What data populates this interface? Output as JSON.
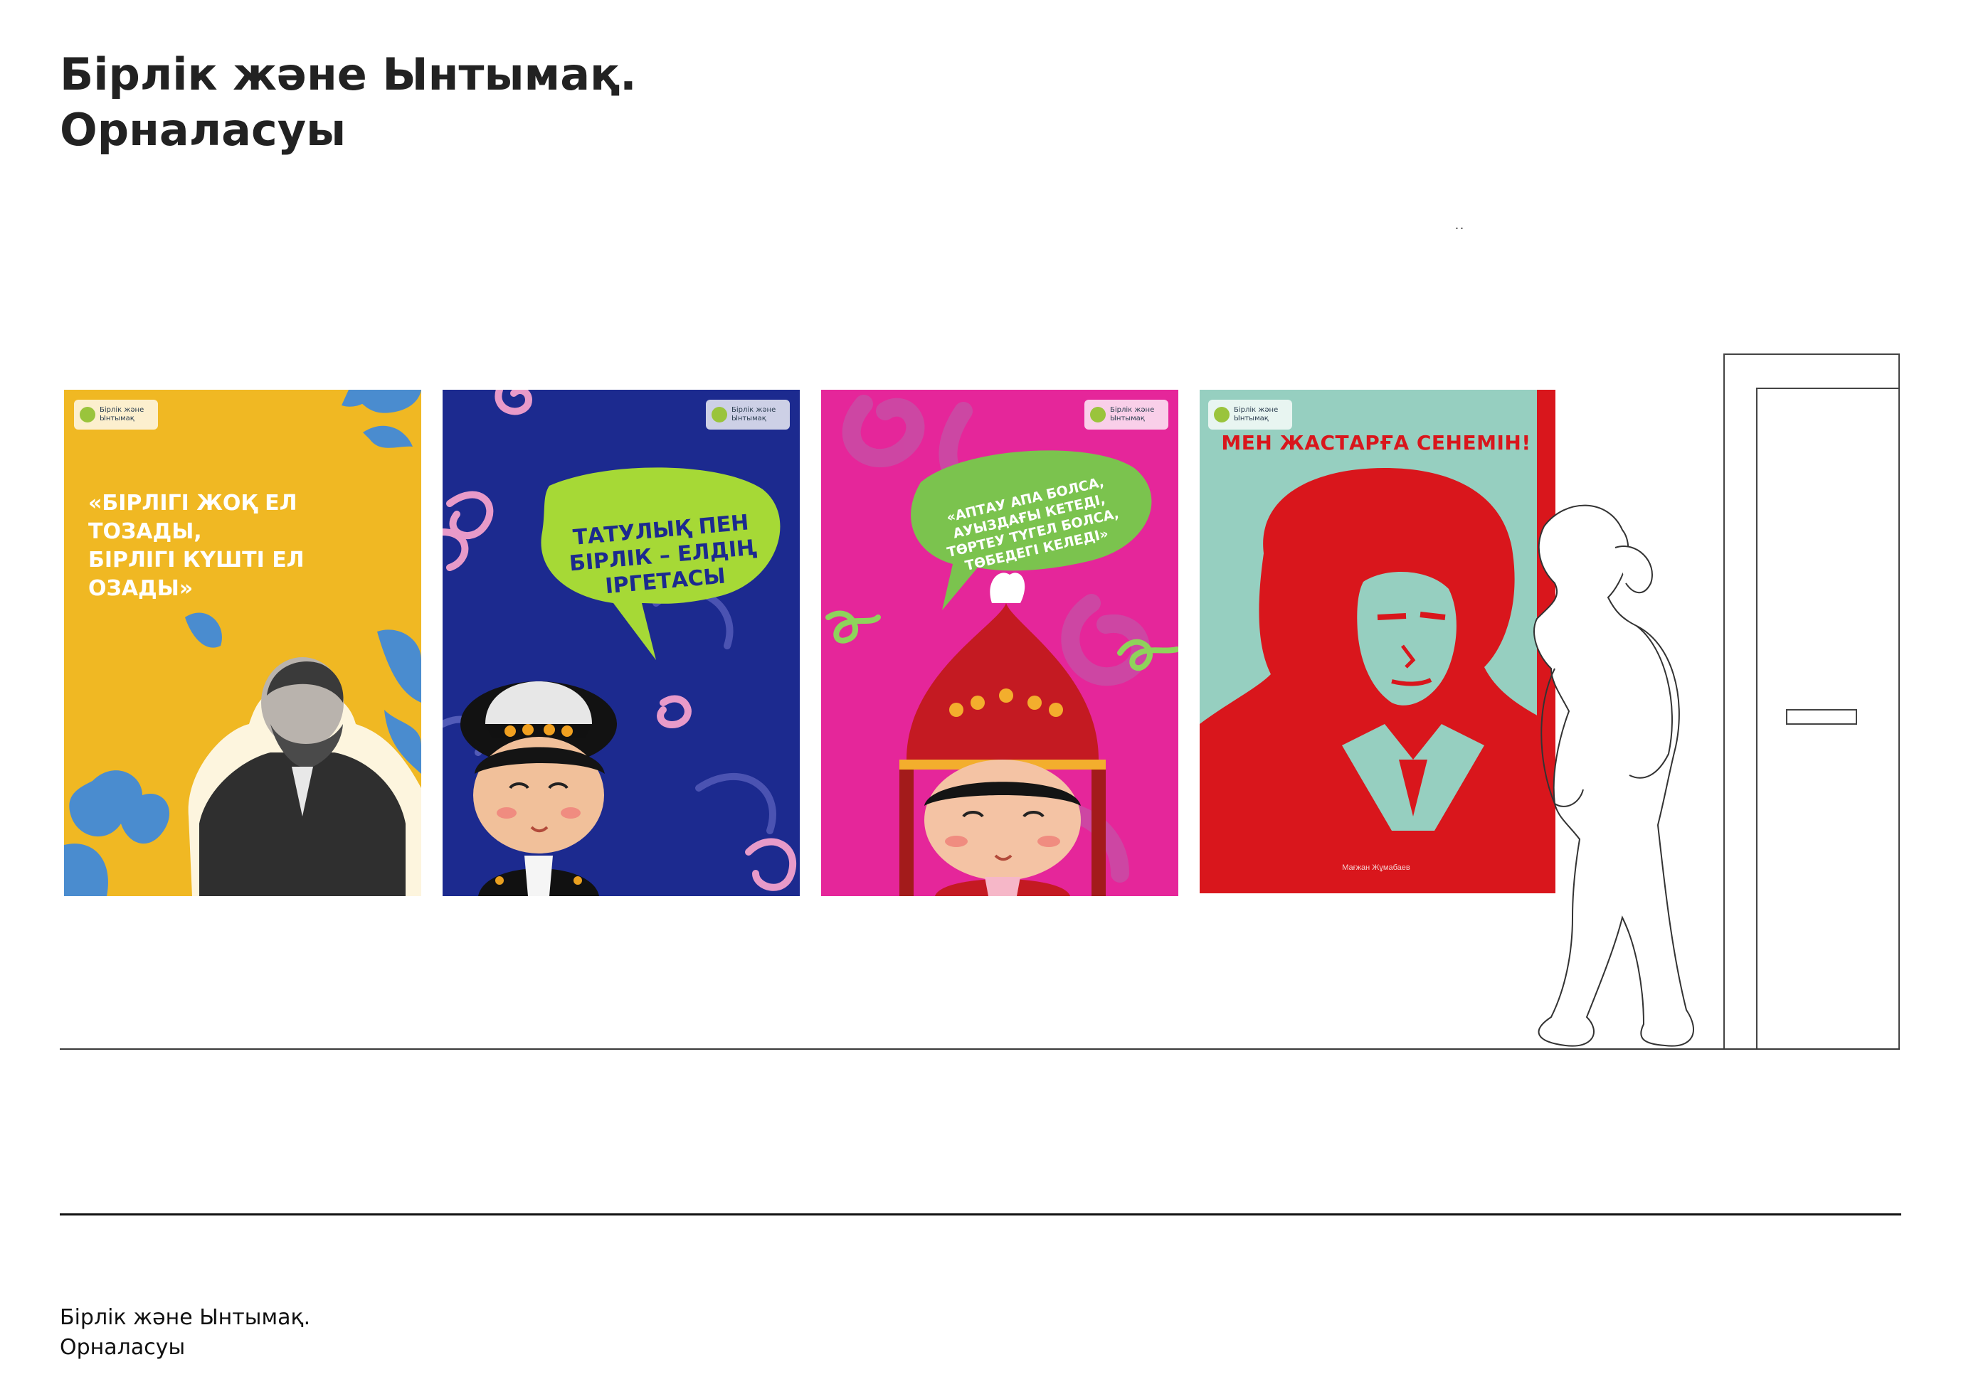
{
  "header": {
    "title_line1": "Бірлік және Ынтымақ.",
    "title_line2": "Орналасуы",
    "marker": ".."
  },
  "footer": {
    "line1": "Бірлік және Ынтымақ.",
    "line2": "Орналасуы"
  },
  "logo": {
    "line1": "Бірлік және",
    "line2": "Ынтымақ"
  },
  "posters": [
    {
      "bg": "#f0b823",
      "quote_line1": "«БІРЛІГІ  ЖОҚ ЕЛ ТОЗАДЫ,",
      "quote_line2": "БІРЛІГІ КҮШТІ ЕЛ ОЗАДЫ»"
    },
    {
      "bg": "#1c2a8f",
      "bubble_line1": "ТАТУЛЫҚ ПЕН",
      "bubble_line2": "БІРЛІК – ЕЛДІҢ",
      "bubble_line3": "ІРГЕТАСЫ"
    },
    {
      "bg": "#e5269a",
      "bubble_line1": "«АПТАУ АПА БОЛСА,",
      "bubble_line2": "АУЫЗДАҒЫ КЕТЕДІ,",
      "bubble_line3": "ТӨРТЕУ ТҮГЕЛ БОЛСА,",
      "bubble_line4": "ТӨБЕДЕГІ КЕЛЕДІ»"
    },
    {
      "bg": "#96cfc0",
      "title": "МЕН ЖАСТАРҒА СЕНЕМІН!",
      "signature": "Мағжан Жұмабаев"
    }
  ]
}
